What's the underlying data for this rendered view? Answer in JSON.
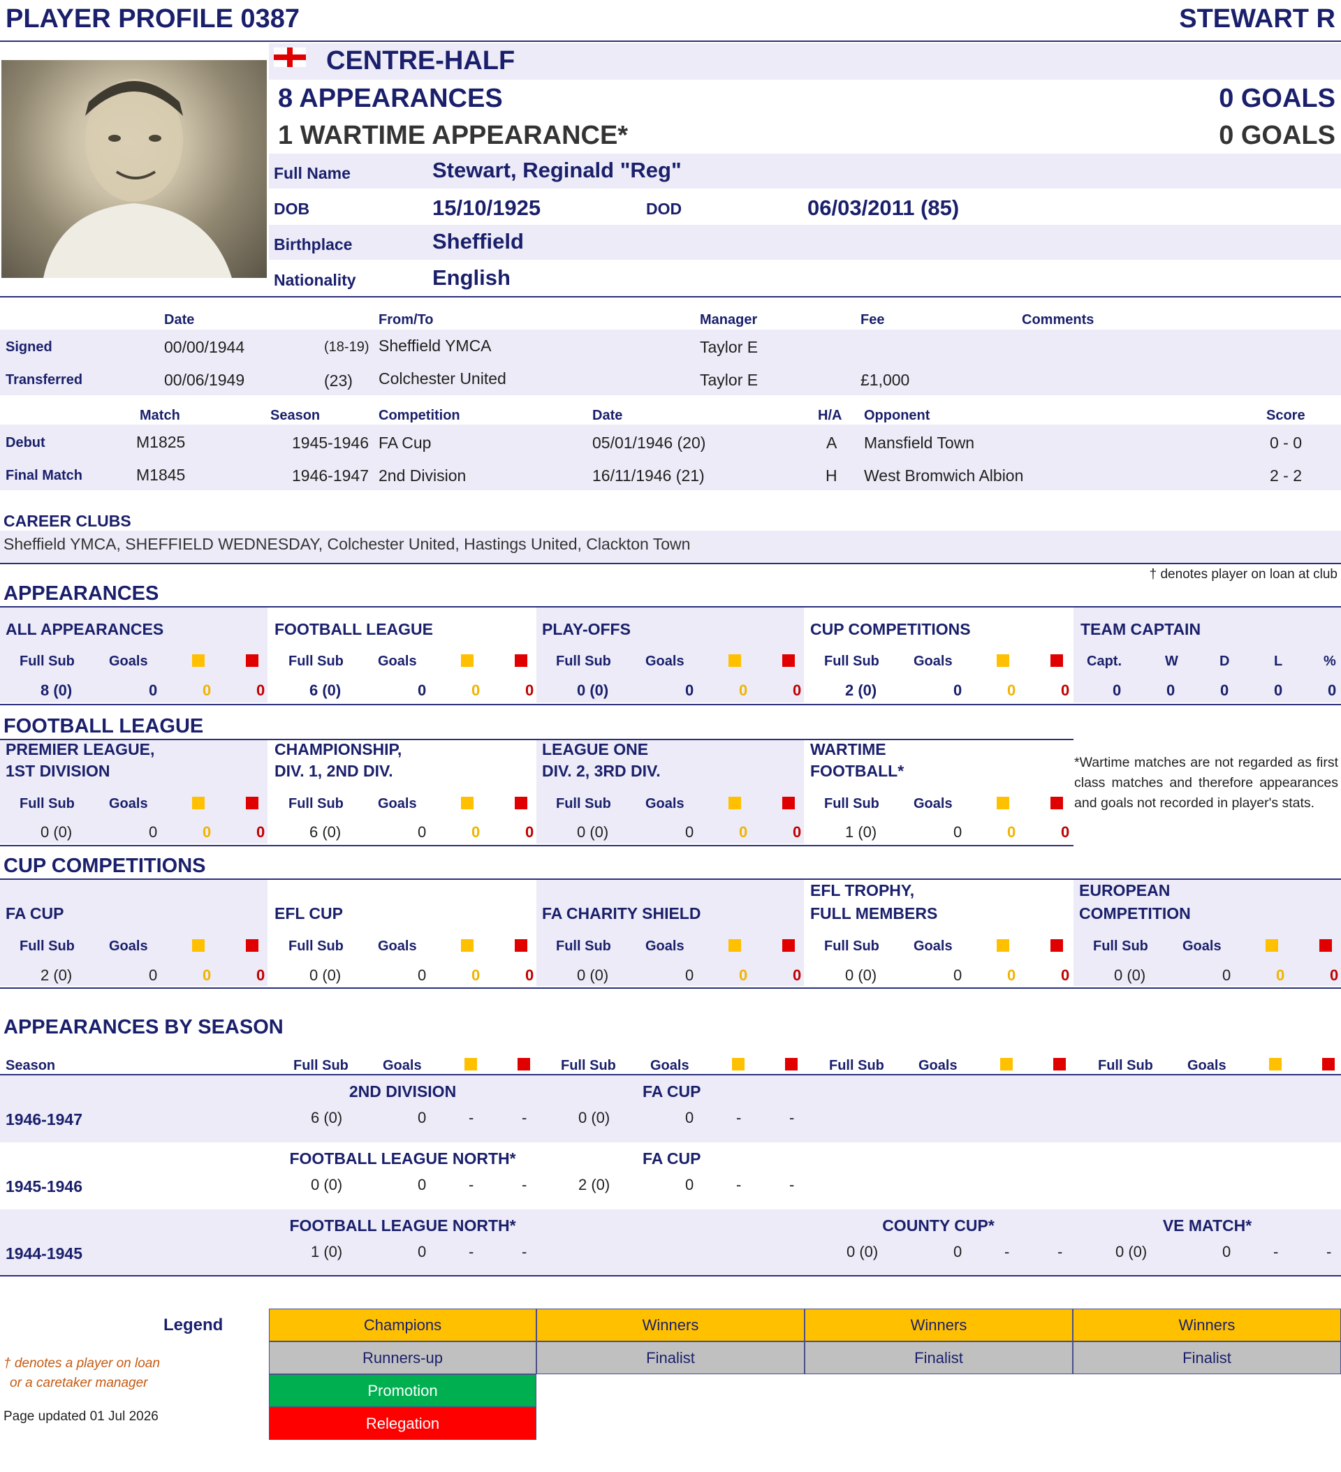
{
  "header": {
    "profile_id": "PLAYER PROFILE 0387",
    "surname": "STEWART R"
  },
  "position": "CENTRE-HALF",
  "summary": {
    "appearances": "8 APPEARANCES",
    "goals": "0 GOALS",
    "wartime_appearances": "1 WARTIME APPEARANCE*",
    "wartime_goals": "0 GOALS"
  },
  "details": {
    "full_name_label": "Full Name",
    "full_name": "Stewart, Reginald \"Reg\"",
    "dob_label": "DOB",
    "dob": "15/10/1925",
    "dod_label": "DOD",
    "dod": "06/03/2011  (85)",
    "birthplace_label": "Birthplace",
    "birthplace": "Sheffield",
    "nationality_label": "Nationality",
    "nationality": "English"
  },
  "transfers": {
    "headers": {
      "date": "Date",
      "from_to": "From/To",
      "manager": "Manager",
      "fee": "Fee",
      "comments": "Comments"
    },
    "rows": [
      {
        "label": "Signed",
        "date": "00/00/1944",
        "age": "(18-19)",
        "club": "Sheffield YMCA",
        "manager": "Taylor E",
        "fee": ""
      },
      {
        "label": "Transferred",
        "date": "00/06/1949",
        "age": "(23)",
        "club": "Colchester United",
        "manager": "Taylor E",
        "fee": "£1,000"
      }
    ]
  },
  "matches": {
    "headers": {
      "match": "Match",
      "season": "Season",
      "competition": "Competition",
      "date": "Date",
      "ha": "H/A",
      "opponent": "Opponent",
      "score": "Score"
    },
    "rows": [
      {
        "label": "Debut",
        "match": "M1825",
        "season": "1945-1946",
        "competition": "FA Cup",
        "date": "05/01/1946  (20)",
        "ha": "A",
        "opponent": "Mansfield Town",
        "score": "0 - 0"
      },
      {
        "label": "Final Match",
        "match": "M1845",
        "season": "1946-1947",
        "competition": "2nd Division",
        "date": "16/11/1946  (21)",
        "ha": "H",
        "opponent": "West Bromwich Albion",
        "score": "2 - 2"
      }
    ]
  },
  "career": {
    "title": "CAREER CLUBS",
    "clubs": "Sheffield YMCA, SHEFFIELD WEDNESDAY, Colchester United, Hastings United, Clackton Town"
  },
  "loan_note": "† denotes player on loan at club",
  "appearances": {
    "title": "APPEARANCES",
    "col_full_sub": "Full Sub",
    "col_goals": "Goals",
    "blocks": [
      {
        "title": "ALL APPEARANCES",
        "apps": "8 (0)",
        "goals": "0",
        "yellow": "0",
        "red": "0"
      },
      {
        "title": "FOOTBALL LEAGUE",
        "apps": "6 (0)",
        "goals": "0",
        "yellow": "0",
        "red": "0"
      },
      {
        "title": "PLAY-OFFS",
        "apps": "0 (0)",
        "goals": "0",
        "yellow": "0",
        "red": "0"
      },
      {
        "title": "CUP COMPETITIONS",
        "apps": "2 (0)",
        "goals": "0",
        "yellow": "0",
        "red": "0"
      }
    ],
    "captain": {
      "title": "TEAM CAPTAIN",
      "h_capt": "Capt.",
      "h_w": "W",
      "h_d": "D",
      "h_l": "L",
      "h_pct": "%",
      "capt": "0",
      "w": "0",
      "d": "0",
      "l": "0",
      "pct": "0"
    }
  },
  "football_league": {
    "title": "FOOTBALL LEAGUE",
    "blocks": [
      {
        "title1": "PREMIER LEAGUE,",
        "title2": "1ST DIVISION",
        "apps": "0 (0)",
        "goals": "0",
        "yellow": "0",
        "red": "0"
      },
      {
        "title1": "CHAMPIONSHIP,",
        "title2": "DIV. 1, 2ND DIV.",
        "apps": "6 (0)",
        "goals": "0",
        "yellow": "0",
        "red": "0"
      },
      {
        "title1": "LEAGUE ONE",
        "title2": "DIV. 2, 3RD DIV.",
        "apps": "0 (0)",
        "goals": "0",
        "yellow": "0",
        "red": "0"
      },
      {
        "title1": "WARTIME",
        "title2": "FOOTBALL*",
        "apps": "1 (0)",
        "goals": "0",
        "yellow": "0",
        "red": "0"
      }
    ],
    "wartime_note": "*Wartime matches are not regarded as first class matches and therefore appearances and goals not recorded in player's stats."
  },
  "cup_competitions": {
    "title": "CUP COMPETITIONS",
    "blocks": [
      {
        "title1": "",
        "title2": "FA CUP",
        "apps": "2 (0)",
        "goals": "0",
        "yellow": "0",
        "red": "0"
      },
      {
        "title1": "",
        "title2": "EFL CUP",
        "apps": "0 (0)",
        "goals": "0",
        "yellow": "0",
        "red": "0"
      },
      {
        "title1": "",
        "title2": "FA CHARITY SHIELD",
        "apps": "0 (0)",
        "goals": "0",
        "yellow": "0",
        "red": "0"
      },
      {
        "title1": "EFL TROPHY,",
        "title2": "FULL MEMBERS",
        "apps": "0 (0)",
        "goals": "0",
        "yellow": "0",
        "red": "0"
      },
      {
        "title1": "EUROPEAN",
        "title2": "COMPETITION",
        "apps": "0 (0)",
        "goals": "0",
        "yellow": "0",
        "red": "0"
      }
    ]
  },
  "by_season": {
    "title": "APPEARANCES BY SEASON",
    "season_header": "Season",
    "rows": [
      {
        "season": "1946-1947",
        "c1": {
          "comp": "2ND DIVISION",
          "apps": "6 (0)",
          "goals": "0",
          "y": "-",
          "r": "-"
        },
        "c2": {
          "comp": "FA CUP",
          "apps": "0 (0)",
          "goals": "0",
          "y": "-",
          "r": "-"
        }
      },
      {
        "season": "1945-1946",
        "c1": {
          "comp": "FOOTBALL LEAGUE NORTH*",
          "apps": "0 (0)",
          "goals": "0",
          "y": "-",
          "r": "-"
        },
        "c2": {
          "comp": "FA CUP",
          "apps": "2 (0)",
          "goals": "0",
          "y": "-",
          "r": "-"
        }
      },
      {
        "season": "1944-1945",
        "c1": {
          "comp": "FOOTBALL LEAGUE NORTH*",
          "apps": "1 (0)",
          "goals": "0",
          "y": "-",
          "r": "-"
        },
        "c3": {
          "comp": "COUNTY CUP*",
          "apps": "0 (0)",
          "goals": "0",
          "y": "-",
          "r": "-"
        },
        "c4": {
          "comp": "VE MATCH*",
          "apps": "0 (0)",
          "goals": "0",
          "y": "-",
          "r": "-"
        }
      }
    ]
  },
  "legend": {
    "title": "Legend",
    "champions": "Champions",
    "winners": "Winners",
    "runners_up": "Runners-up",
    "finalist": "Finalist",
    "promotion": "Promotion",
    "relegation": "Relegation",
    "loan_note_1": "† denotes a player on loan",
    "loan_note_2": "or a caretaker manager",
    "updated": "Page updated 01 Jul 2026"
  },
  "colors": {
    "navy": "#1a1f6b",
    "shade": "#ecebf7",
    "gold": "#ffc000",
    "grey": "#c0c0c0",
    "green": "#00b050",
    "red": "#ff0000"
  }
}
